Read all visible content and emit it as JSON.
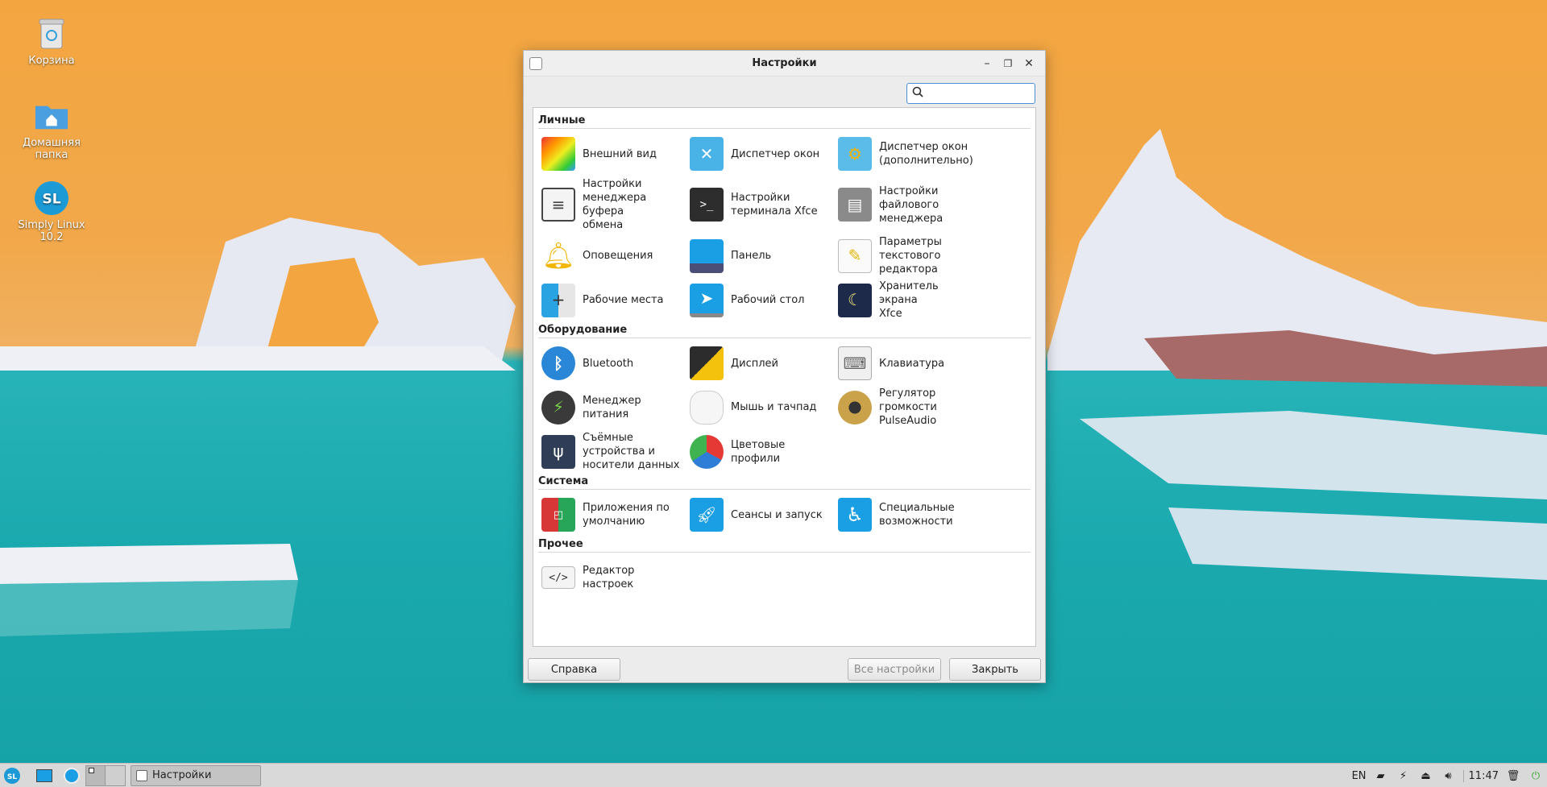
{
  "desktop": {
    "icons": [
      {
        "label": "Корзина",
        "icon": "trash-icon"
      },
      {
        "label": "Домашняя\nпапка",
        "icon": "home-folder-icon"
      },
      {
        "label": "Simply Linux\n10.2",
        "icon": "simply-linux-icon"
      }
    ]
  },
  "window": {
    "title": "Настройки",
    "search": {
      "value": "",
      "placeholder": ""
    },
    "categories": [
      {
        "name": "Личные",
        "items": [
          {
            "label": "Внешний вид",
            "icon": "appearance-icon"
          },
          {
            "label": "Диспетчер окон",
            "icon": "window-manager-icon"
          },
          {
            "label": "Диспетчер окон\n(дополнительно)",
            "icon": "window-manager-tweaks-icon"
          },
          {
            "label": "Настройки\nменеджера буфера\nобмена",
            "icon": "clipboard-icon"
          },
          {
            "label": "Настройки\nтерминала Xfce",
            "icon": "terminal-icon"
          },
          {
            "label": "Настройки\nфайлового\nменеджера",
            "icon": "file-manager-icon"
          },
          {
            "label": "Оповещения",
            "icon": "notifications-bell-icon"
          },
          {
            "label": "Панель",
            "icon": "panel-icon"
          },
          {
            "label": "Параметры\nтекстового\nредактора",
            "icon": "text-editor-icon"
          },
          {
            "label": "Рабочие места",
            "icon": "workspaces-icon"
          },
          {
            "label": "Рабочий стол",
            "icon": "desktop-icon"
          },
          {
            "label": "Хранитель экрана\nXfce",
            "icon": "screensaver-icon"
          }
        ]
      },
      {
        "name": "Оборудование",
        "items": [
          {
            "label": "Bluetooth",
            "icon": "bluetooth-icon"
          },
          {
            "label": "Дисплей",
            "icon": "display-icon"
          },
          {
            "label": "Клавиатура",
            "icon": "keyboard-icon"
          },
          {
            "label": "Менеджер питания",
            "icon": "battery-icon"
          },
          {
            "label": "Мышь и тачпад",
            "icon": "mouse-icon"
          },
          {
            "label": "Регулятор\nгромкости\nPulseAudio",
            "icon": "speaker-icon"
          },
          {
            "label": "Съёмные\nустройства и\nносители данных",
            "icon": "usb-drive-icon"
          },
          {
            "label": "Цветовые профили",
            "icon": "color-profiles-icon"
          }
        ]
      },
      {
        "name": "Система",
        "items": [
          {
            "label": "Приложения по\nумолчанию",
            "icon": "default-apps-icon"
          },
          {
            "label": "Сеансы и запуск",
            "icon": "rocket-icon"
          },
          {
            "label": "Специальные\nвозможности",
            "icon": "accessibility-icon"
          }
        ]
      },
      {
        "name": "Прочее",
        "items": [
          {
            "label": "Редактор настроек",
            "icon": "settings-editor-icon"
          }
        ]
      }
    ],
    "buttons": {
      "help": "Справка",
      "all_settings": "Все настройки",
      "close": "Закрыть"
    }
  },
  "taskbar": {
    "task_label": "Настройки",
    "keyboard_layout": "EN",
    "clock": "11:47"
  }
}
